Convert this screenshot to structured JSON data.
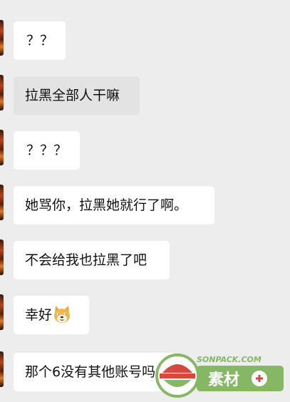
{
  "messages": [
    {
      "text": "？？"
    },
    {
      "text": "拉黑全部人干嘛"
    },
    {
      "text": "？？？"
    },
    {
      "text": "她骂你，拉黑她就行了啊。"
    },
    {
      "text": "不会给我也拉黑了吧"
    },
    {
      "text": "幸好",
      "emoji": "doge-emoji-icon"
    },
    {
      "text": "那个6没有其他账号吗"
    }
  ],
  "watermark": {
    "brand_latin": "SONPACK.COM",
    "brand_cn": "素材",
    "logo_icon": "sonpack-logo-icon"
  },
  "colors": {
    "chat_background": "#ededed",
    "bubble": "#ffffff",
    "bubble_selected": "#e3e3e3",
    "watermark_green": "#7db35a",
    "watermark_red": "#d33b2f"
  }
}
